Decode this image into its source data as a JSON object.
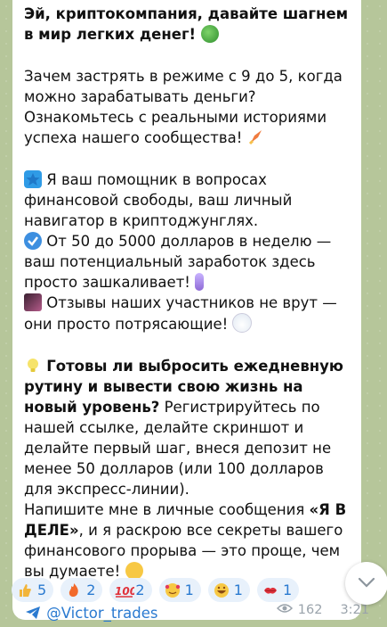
{
  "message": {
    "title_line": "Эй, криптокомпания, давайте шагнем в мир легких денег!",
    "p1": "Зачем застрять в режиме с 9 до 5, когда можно зарабатывать деньги? Ознакомьтесь с реальными историями успеха нашего сообщества!",
    "p2_line1": "Я ваш помощник в вопросах финансовой свободы, ваш личный навигатор в криптоджунглях.",
    "p2_line2": "От 50 до 5000 долларов в неделю — ваш потенциальный заработок здесь просто зашкаливает!",
    "p2_line3": "Отзывы наших участников не врут — они просто потрясающие!",
    "p3_bold": "Готовы ли выбросить ежедневную рутину и вывести свою жизнь на новый уровень?",
    "p3_rest": " Регистрируйтесь по нашей ссылке, делайте скриншот и делайте первый шаг, внеся депозит не менее 50 долларов (или 100 долларов для экспресс-линии).",
    "p4_start": "Напишите мне в личные сообщения ",
    "p4_bold": "«Я В ДЕЛЕ»",
    "p4_end": ", и я раскрою все секреты вашего финансового прорыва — это проще, чем вы думаете!",
    "handle": "@Victor_trades"
  },
  "reactions": [
    {
      "icon": "thumbs-up",
      "count": "5"
    },
    {
      "icon": "fire",
      "count": "2"
    },
    {
      "icon": "hundred-points",
      "count": "2"
    },
    {
      "icon": "smiling-face-with-hearts",
      "count": "1"
    },
    {
      "icon": "rofl",
      "count": "1"
    },
    {
      "icon": "kiss-mark",
      "count": "1"
    }
  ],
  "footer": {
    "views": "162",
    "time": "3:21"
  },
  "colors": {
    "link": "#2a7ad0",
    "chip_bg": "#e8f1fb",
    "chat_bg": "#b6c69a"
  }
}
